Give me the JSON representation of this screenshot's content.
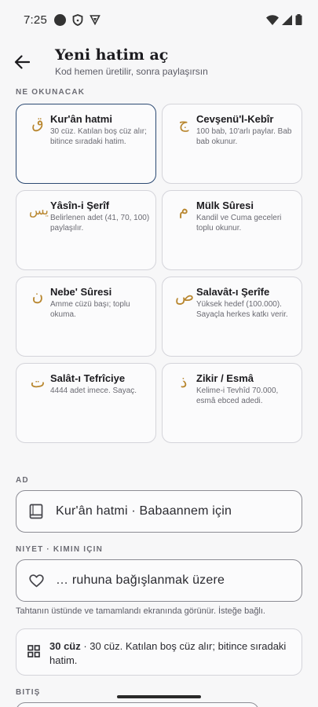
{
  "status_bar": {
    "time": "7:25",
    "left_icons": [
      "circle-icon",
      "shield-icon",
      "vpn-icon"
    ],
    "right_icons": [
      "wifi-icon",
      "signal-icon",
      "battery-icon"
    ]
  },
  "header": {
    "title": "Yeni hatim aç",
    "subtitle": "Kod hemen üretilir, sonra paylaşırsın"
  },
  "section_what": {
    "label": "NE OKUNACAK"
  },
  "cards": [
    {
      "glyph": "ق",
      "title": "Kur'ân hatmi",
      "desc": "30 cüz. Katılan boş cüz alır; bitince sıradaki hatim.",
      "selected": true
    },
    {
      "glyph": "ج",
      "title": "Cevşenü'l-Kebîr",
      "desc": "100 bab, 10'arlı paylar. Bab bab okunur.",
      "selected": false
    },
    {
      "glyph": "يس",
      "title": "Yâsîn-i Şerîf",
      "desc": "Belirlenen adet (41, 70, 100) paylaşılır.",
      "selected": false
    },
    {
      "glyph": "م",
      "title": "Mülk Sûresi",
      "desc": "Kandil ve Cuma geceleri toplu okunur.",
      "selected": false
    },
    {
      "glyph": "ن",
      "title": "Nebe' Sûresi",
      "desc": "Amme cüzü başı; toplu okuma.",
      "selected": false
    },
    {
      "glyph": "ص",
      "title": "Salavât-ı Şerîfe",
      "desc": "Yüksek hedef (100.000). Sayaçla herkes katkı verir.",
      "selected": false
    },
    {
      "glyph": "ت",
      "title": "Salât-ı Tefrîciye",
      "desc": "4444 adet imece. Sayaç.",
      "selected": false
    },
    {
      "glyph": "ذ",
      "title": "Zikir / Esmâ",
      "desc": "Kelime-i Tevhîd 70.000, esmâ ebced adedi.",
      "selected": false
    }
  ],
  "section_name": {
    "label": "AD",
    "value": "Kur'ân hatmi · Babaannem için",
    "icon": "book-icon"
  },
  "section_intent": {
    "label": "NIYET · KIMIN IÇIN",
    "value": "… ruhuna bağışlanmak üzere",
    "icon": "heart-icon",
    "helper": "Tahtanın üstünde ve tamamlandı ekranında görünür. İsteğe bağlı."
  },
  "summary": {
    "icon": "grid-icon",
    "bold": "30 cüz",
    "text": " · 30 cüz. Katılan boş cüz alır; bitince sıradaki hatim."
  },
  "section_end": {
    "label": "BITIŞ"
  },
  "colors": {
    "accent_gold": "#b8862e",
    "selected_border": "#2c4a73"
  }
}
